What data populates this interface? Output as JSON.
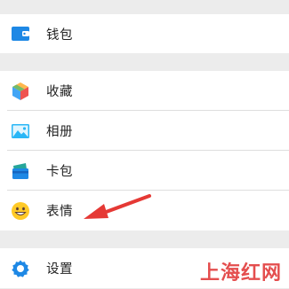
{
  "menu": {
    "wallet": {
      "label": "钱包",
      "icon": "wallet-icon"
    },
    "favorites": {
      "label": "收藏",
      "icon": "favorites-cube-icon"
    },
    "album": {
      "label": "相册",
      "icon": "photo-icon"
    },
    "cards": {
      "label": "卡包",
      "icon": "card-holder-icon"
    },
    "stickers": {
      "label": "表情",
      "icon": "smiley-icon"
    },
    "settings": {
      "label": "设置",
      "icon": "gear-icon"
    }
  },
  "annotation": {
    "arrow_color": "#e53935"
  },
  "watermark": {
    "text": "上海红网"
  },
  "colors": {
    "background": "#ececec",
    "wallet_blue": "#1e88e5",
    "settings_blue": "#1e88e5",
    "smiley_yellow": "#ffca28",
    "watermark_red": "#e24040"
  }
}
